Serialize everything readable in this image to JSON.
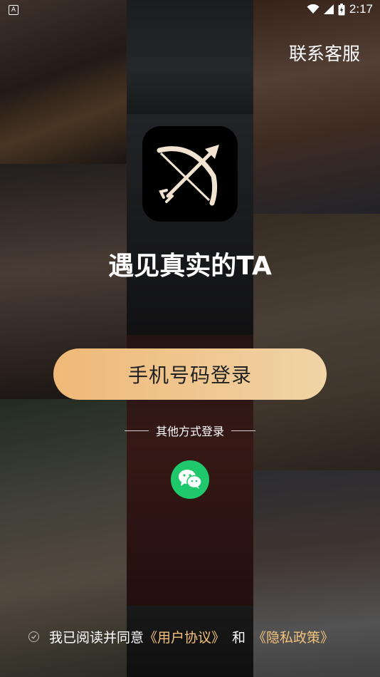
{
  "status_bar": {
    "time": "2:17",
    "app_indicator": "A"
  },
  "header": {
    "contact_label": "联系客服"
  },
  "logo": {
    "icon": "bow-and-arrow-icon"
  },
  "tagline": "遇见真实的TA",
  "login": {
    "phone_button": "手机号码登录",
    "other_methods": "其他方式登录",
    "wechat_icon": "wechat-icon"
  },
  "agreement": {
    "prefix": "我已阅读并同意",
    "user_agreement": "《用户协议》",
    "and": "和",
    "privacy_policy": "《隐私政策》"
  },
  "colors": {
    "primary_start": "#efb877",
    "primary_end": "#f0d4a6",
    "link": "#f2c27c",
    "wechat": "#1fc86a"
  }
}
